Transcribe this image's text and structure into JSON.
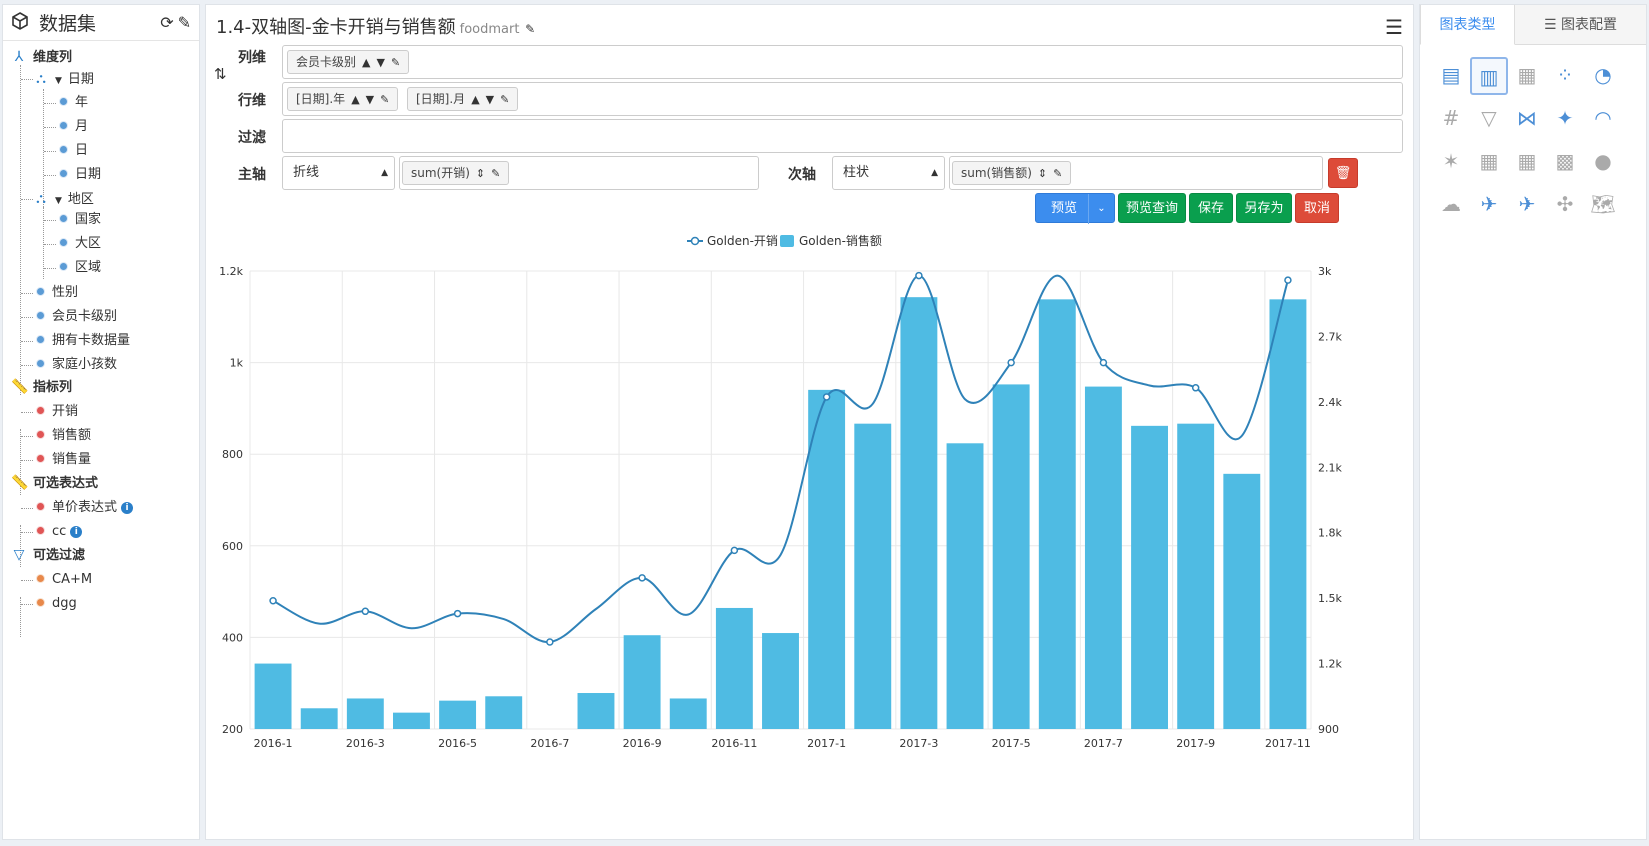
{
  "sidebar": {
    "title": "数据集",
    "groups": {
      "dims": "维度列",
      "date": "日期",
      "year": "年",
      "month": "月",
      "day": "日",
      "date2": "日期",
      "region": "地区",
      "country": "国家",
      "area": "大区",
      "zone": "区域",
      "gender": "性别",
      "level": "会员卡级别",
      "cards": "拥有卡数据量",
      "kids": "家庭小孩数",
      "measures": "指标列",
      "m1": "开销",
      "m2": "销售额",
      "m3": "销售量",
      "exprs": "可选表达式",
      "e1": "单价表达式",
      "e2": "cc",
      "filters": "可选过滤",
      "f1": "CA+M",
      "f2": "dgg"
    }
  },
  "header": {
    "title": "1.4-双轴图-金卡开销与销售额",
    "subtitle": "foodmart"
  },
  "config": {
    "col_label": "列维",
    "row_label": "行维",
    "filter_label": "过滤",
    "main_axis_label": "主轴",
    "second_axis_label": "次轴",
    "col_pill": "会员卡级别",
    "row_pill_1": "[日期].年",
    "row_pill_2": "[日期].月",
    "main_type": "折线",
    "main_measure": "sum(开销)",
    "second_type": "柱状",
    "second_measure": "sum(销售额)"
  },
  "buttons": {
    "preview": "预览",
    "preview_query": "预览查询",
    "save": "保存",
    "save_as": "另存为",
    "cancel": "取消"
  },
  "right_panel": {
    "tab_types": "图表类型",
    "tab_config": "图表配置"
  },
  "colors": {
    "line": "#2f82b8",
    "bar": "#4fbbe3",
    "accent": "#3c8dee"
  },
  "chart_data": {
    "type": "bar",
    "categories": [
      "2016-1",
      "2016-2",
      "2016-3",
      "2016-4",
      "2016-5",
      "2016-6",
      "2016-7",
      "2016-8",
      "2016-9",
      "2016-10",
      "2016-11",
      "2016-12",
      "2017-1",
      "2017-2",
      "2017-3",
      "2017-4",
      "2017-5",
      "2017-6",
      "2017-7",
      "2017-8",
      "2017-9",
      "2017-10",
      "2017-11"
    ],
    "xtick_labels": [
      "2016-1",
      "2016-3",
      "2016-5",
      "2016-7",
      "2016-9",
      "2016-11",
      "2017-1",
      "2017-3",
      "2017-5",
      "2017-7",
      "2017-9",
      "2017-11"
    ],
    "series": [
      {
        "name": "Golden-开销",
        "type": "line",
        "axis": "left",
        "values": [
          480,
          430,
          457,
          420,
          452,
          440,
          390,
          462,
          530,
          450,
          590,
          580,
          925,
          910,
          1190,
          920,
          1000,
          1190,
          1000,
          950,
          945,
          840,
          1180
        ]
      },
      {
        "name": "Golden-销售额",
        "type": "bar",
        "axis": "right",
        "values": [
          1200,
          995,
          1040,
          975,
          1030,
          1050,
          888,
          1065,
          1330,
          1040,
          1455,
          1340,
          2455,
          2300,
          2880,
          2210,
          2480,
          2870,
          2470,
          2290,
          2300,
          2070,
          2870
        ]
      }
    ],
    "yleft": {
      "lim": [
        200,
        1200
      ],
      "ticks": [
        "200",
        "400",
        "600",
        "800",
        "1k",
        "1.2k"
      ]
    },
    "yright": {
      "lim": [
        900,
        3000
      ],
      "ticks": [
        "900",
        "1.2k",
        "1.5k",
        "1.8k",
        "2.1k",
        "2.4k",
        "2.7k",
        "3k"
      ]
    },
    "grid": true,
    "legend": "top-center"
  }
}
